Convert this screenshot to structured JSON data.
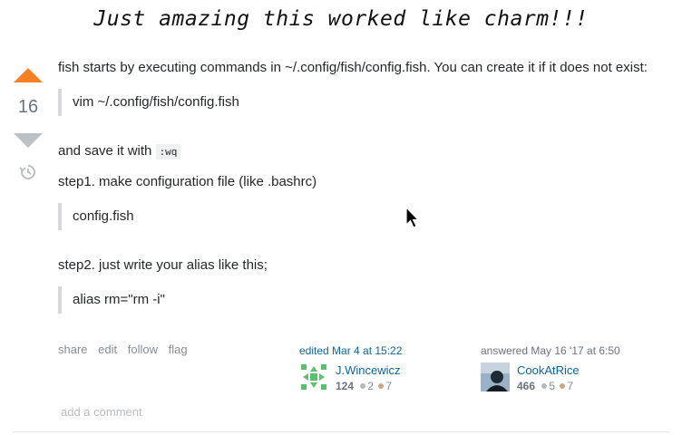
{
  "headline": "Just amazing this worked like charm!!!",
  "vote": {
    "score": "16",
    "up_icon": "arrow-up-icon",
    "down_icon": "arrow-down-icon",
    "history_icon": "history-icon"
  },
  "post": {
    "intro": "fish starts by executing commands in ~/.config/fish/config.fish. You can create it if it does not exist:",
    "quote1": "vim ~/.config/fish/config.fish",
    "save_text": "and save it with",
    "save_code": ":wq",
    "step1": "step1. make configuration file (like .bashrc)",
    "quote2": "config.fish",
    "step2": "step2. just write your alias like this;",
    "quote3": "alias rm=\"rm -i\""
  },
  "menu": {
    "share": "share",
    "edit": "edit",
    "follow": "follow",
    "flag": "flag"
  },
  "editor": {
    "action": "edited Mar 4 at 15:22",
    "name": "J.Wincewicz",
    "rep": "124",
    "silver": "2",
    "bronze": "7"
  },
  "answerer": {
    "action": "answered May 16 '17 at 6:50",
    "name": "CookAtRice",
    "rep": "466",
    "silver": "5",
    "bronze": "7"
  },
  "add_comment": "add a comment",
  "colors": {
    "upvote": "#f48024",
    "downvote": "#bbc0c4",
    "link": "#0c65a5",
    "quote_border": "#d6d9dc",
    "silver_badge": "#b4b8bc",
    "bronze_badge": "#d1a684"
  }
}
